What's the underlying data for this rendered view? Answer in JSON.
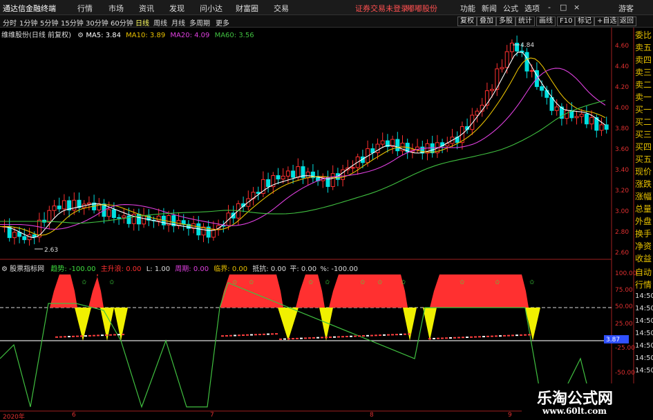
{
  "menubar": {
    "app_title": "通达信金融终端",
    "items": [
      "行情",
      "市场",
      "资讯",
      "发现",
      "问小达",
      "财富圈",
      "交易"
    ],
    "notice": "证券交易未登录",
    "notice2": "嘟嘟股份",
    "right_items": [
      "功能",
      "新闻",
      "公式",
      "选项"
    ],
    "window_controls": [
      "-",
      "□",
      "×"
    ],
    "guest": "游客"
  },
  "period_bar": {
    "items": [
      "分时",
      "1分钟",
      "5分钟",
      "15分钟",
      "30分钟",
      "60分钟",
      "日线",
      "周线",
      "月线",
      "多周期",
      "更多"
    ],
    "active": "日线",
    "tools": [
      "复权",
      "叠加",
      "多股",
      "统计",
      "画线",
      "F10",
      "标记",
      "+自选",
      "返回"
    ]
  },
  "price_panel": {
    "stock": "维维股份(日线 前复权)",
    "ma5": "MA5: 3.84",
    "ma10": "MA10: 3.89",
    "ma20": "MA20: 4.09",
    "ma60": "MA60: 3.56",
    "high_label": "4.84",
    "low_label": "2.63",
    "axis": [
      "4.60",
      "4.40",
      "4.20",
      "4.00",
      "3.80",
      "3.60",
      "3.40",
      "3.20",
      "3.00",
      "2.80",
      "2.60"
    ]
  },
  "indicator_panel": {
    "name": "股票指标网",
    "trend": "趋势: -100.00",
    "rise": "主升浪: 0.00",
    "l": "L: 1.00",
    "cycle": "周期: 0.00",
    "critical": "临界: 0.00",
    "resist": "抵抗: 0.00",
    "flat": "平: 0.00",
    "pct": "%: -100.00",
    "axis": [
      "100.00",
      "75.00",
      "50.00",
      "25.00",
      "0.00",
      "-25.00",
      "-50.00"
    ],
    "marker_value": "3.87"
  },
  "side_panel": {
    "top": [
      "委比",
      "卖五",
      "卖四",
      "卖三",
      "卖二",
      "卖一",
      "买一",
      "买二",
      "买三",
      "买四",
      "买五",
      "现价",
      "涨跌",
      "涨幅",
      "总量",
      "外盘",
      "换手",
      "净资",
      "收益"
    ],
    "bottom_label": "自动",
    "bottom_label2": "行情",
    "times": [
      "14:50",
      "14:50",
      "14:50",
      "14:50",
      "14:50",
      "14:50",
      "14:50"
    ]
  },
  "dates": [
    "2020年",
    "6",
    "7",
    "8",
    "9"
  ],
  "watermark": {
    "line1": "乐淘公式网",
    "line2": "www.60lt.com"
  },
  "colors": {
    "up": "#ff3030",
    "down": "#00e0e0",
    "ma5": "#ffffff",
    "ma10": "#e8c000",
    "ma20": "#e040e0",
    "ma60": "#40c040"
  }
}
